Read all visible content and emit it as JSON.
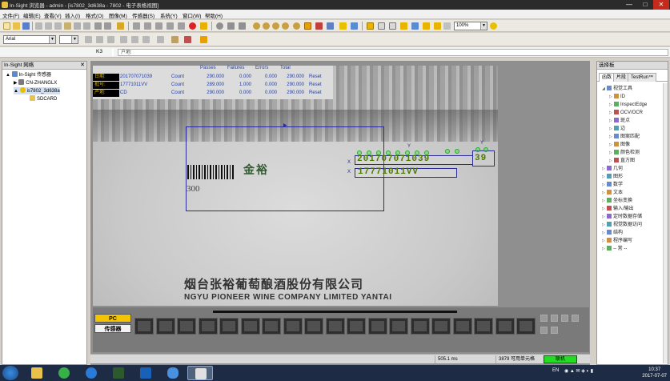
{
  "window": {
    "title": "In-Sight 浏览器 - admin - [is7802_3d638a - 7802 - 电子表格视图]",
    "minimize": "—",
    "maximize": "□",
    "close": "✕"
  },
  "menu": [
    "文件(F)",
    "编辑(E)",
    "查看(V)",
    "插入(I)",
    "格式(O)",
    "图像(M)",
    "传感器(S)",
    "系统(Y)",
    "窗口(W)",
    "帮助(H)"
  ],
  "toolbar": {
    "zoom_value": "100%",
    "font_value": "Arial"
  },
  "cellbar": {
    "cell_ref": "K3",
    "formula": "户地:"
  },
  "left_panel": {
    "title": "In-Sight 网络",
    "tree": [
      {
        "label": "In-Sight 传感器",
        "indent": 0,
        "expander": "▲"
      },
      {
        "label": "CN-ZHANGLX",
        "indent": 1,
        "expander": "▶"
      },
      {
        "label": "is7802_3d638a",
        "indent": 1,
        "expander": "▲"
      },
      {
        "label": "SDCARD",
        "indent": 2,
        "expander": ""
      }
    ]
  },
  "results": {
    "headers": [
      "Passes",
      "Failures",
      "Errors",
      "Total"
    ],
    "rows": [
      {
        "label": "日期:",
        "value": "201707071039",
        "link": "Count",
        "passes": "290.000",
        "failures": "0.000",
        "errors": "0.000",
        "total": "290.000",
        "reset": "Reset"
      },
      {
        "label": "批号:",
        "value": "17771011VV",
        "link": "Count",
        "passes": "289.000",
        "failures": "1.000",
        "errors": "0.000",
        "total": "290.000",
        "reset": "Reset"
      },
      {
        "label": "产地:",
        "value": "CD",
        "link": "Count",
        "passes": "290.000",
        "failures": "0.000",
        "errors": "0.000",
        "total": "290.000",
        "reset": "Reset"
      }
    ]
  },
  "image": {
    "ocr_date": "201707071039",
    "ocr_batch": "17771011VV",
    "ocr_place": "39",
    "marker_y1": "Y",
    "marker_y2": "Y",
    "marker_x1": "X",
    "marker_x2": "X",
    "gold_text": "金裕",
    "number_300": "300",
    "company_cn": "烟台张裕葡萄酿酒股份有限公司",
    "company_en": "NGYU PIONEER WINE COMPANY LIMITED YANTAI"
  },
  "filmstrip": {
    "pc_label": "PC",
    "sensor_label": "传感器",
    "thumb_count": 19
  },
  "status": {
    "time_ms": "505.1 ms",
    "free_cells": "3879 可用单元格",
    "online": "联机"
  },
  "right_panel": {
    "title": "选择板",
    "tabs": [
      "函数",
      "片段",
      "TestRun™"
    ],
    "items": [
      {
        "label": "视觉工具",
        "indent": 0,
        "expander": "◢"
      },
      {
        "label": "ID",
        "indent": 1,
        "expander": "▷"
      },
      {
        "label": "InspectEdge",
        "indent": 1,
        "expander": "▷"
      },
      {
        "label": "OCV/OCR",
        "indent": 1,
        "expander": "▷"
      },
      {
        "label": "斑点",
        "indent": 1,
        "expander": "▷"
      },
      {
        "label": "边",
        "indent": 1,
        "expander": "▷"
      },
      {
        "label": "图案匹配",
        "indent": 1,
        "expander": "▷"
      },
      {
        "label": "图像",
        "indent": 1,
        "expander": "▷"
      },
      {
        "label": "颜色检测",
        "indent": 1,
        "expander": "▷"
      },
      {
        "label": "直方图",
        "indent": 1,
        "expander": "▷"
      },
      {
        "label": "几何",
        "indent": 0,
        "expander": "▷"
      },
      {
        "label": "图形",
        "indent": 0,
        "expander": "▷"
      },
      {
        "label": "数学",
        "indent": 0,
        "expander": "▷"
      },
      {
        "label": "文本",
        "indent": 0,
        "expander": "▷"
      },
      {
        "label": "坐标变换",
        "indent": 0,
        "expander": "▷"
      },
      {
        "label": "输入/输出",
        "indent": 0,
        "expander": "▷"
      },
      {
        "label": "定时数据存储",
        "indent": 0,
        "expander": "▷"
      },
      {
        "label": "视觉数据访问",
        "indent": 0,
        "expander": "▷"
      },
      {
        "label": "结构",
        "indent": 0,
        "expander": "▷"
      },
      {
        "label": "程序编写",
        "indent": 0,
        "expander": "▷"
      },
      {
        "label": "-- 常 --",
        "indent": 0,
        "expander": "▷"
      }
    ]
  },
  "taskbar": {
    "tray_lang": "EN",
    "time": "10:37",
    "date": "2017-07-07"
  },
  "colors": {
    "accent_online": "#22dd22",
    "result_text": "#1f3ea8",
    "label_text": "#d7b600",
    "ocr_green": "#4d7a00",
    "roi_blue": "#2a2a9a"
  }
}
